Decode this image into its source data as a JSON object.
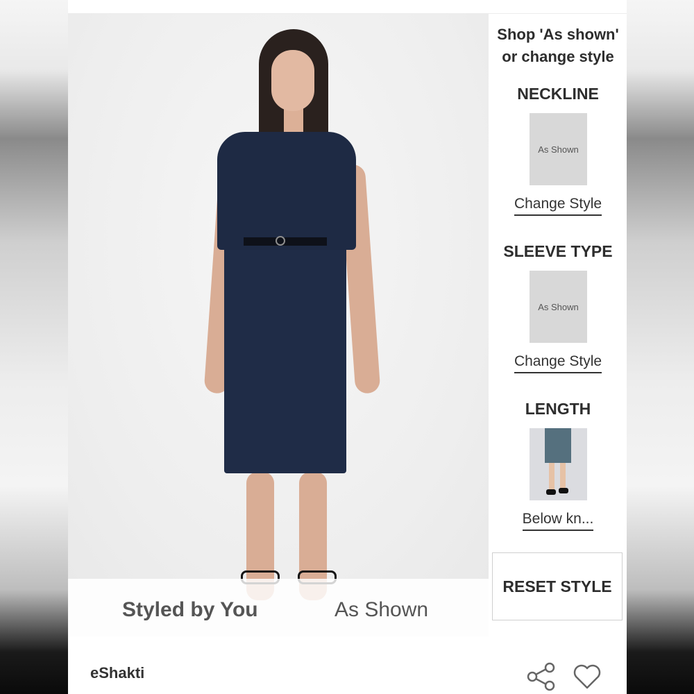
{
  "right_panel": {
    "heading_line1": "Shop 'As shown'",
    "heading_line2": "or change style",
    "sections": [
      {
        "title": "NECKLINE",
        "thumb_label": "As Shown",
        "link_label": "Change Style"
      },
      {
        "title": "SLEEVE TYPE",
        "thumb_label": "As Shown",
        "link_label": "Change Style"
      },
      {
        "title": "LENGTH",
        "thumb_label": "",
        "link_label": "Below kn..."
      }
    ],
    "reset_label": "RESET STYLE"
  },
  "style_toggle": {
    "styled_label": "Styled by You",
    "as_shown_label": "As Shown"
  },
  "bottom_bar": {
    "brand": "eShakti"
  },
  "colors": {
    "dress": "#1f2c47",
    "text": "#2d2d2d"
  },
  "icons": [
    "share-icon",
    "heart-icon"
  ]
}
